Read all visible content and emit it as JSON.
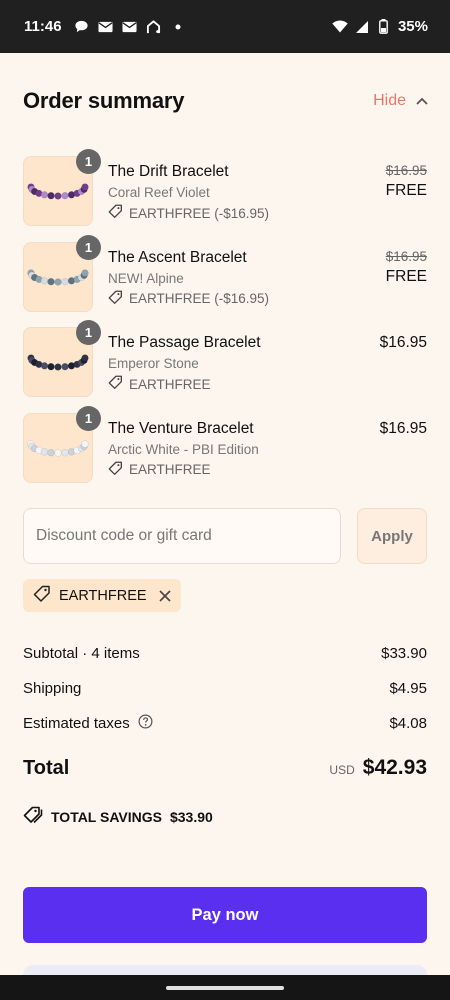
{
  "status_bar": {
    "time": "11:46",
    "battery": "35%",
    "icons": [
      "chat-bubble-icon",
      "mail-icon",
      "mail-icon",
      "home-icon",
      "dot-icon",
      "wifi-icon",
      "signal-icon",
      "battery-icon"
    ]
  },
  "header": {
    "title": "Order summary",
    "toggle_label": "Hide",
    "accent_color": "#e8786b"
  },
  "items": [
    {
      "name": "The Drift Bracelet",
      "variant": "Coral Reef Violet",
      "code": "EARTHFREE (-$16.95)",
      "original_price": "$16.95",
      "price": "FREE",
      "qty": "1",
      "bead_colors": [
        "#6e3d8c",
        "#b08ac8",
        "#4f2a6b"
      ]
    },
    {
      "name": "The Ascent Bracelet",
      "variant": "NEW! Alpine",
      "code": "EARTHFREE (-$16.95)",
      "original_price": "$16.95",
      "price": "FREE",
      "qty": "1",
      "bead_colors": [
        "#8ea3b0",
        "#d6dde2",
        "#5e7482"
      ]
    },
    {
      "name": "The Passage Bracelet",
      "variant": "Emperor Stone",
      "code": "EARTHFREE",
      "original_price": "",
      "price": "$16.95",
      "qty": "1",
      "bead_colors": [
        "#2f3146",
        "#4a4c66",
        "#1e2030"
      ]
    },
    {
      "name": "The Venture Bracelet",
      "variant": "Arctic White - PBI Edition",
      "code": "EARTHFREE",
      "original_price": "",
      "price": "$16.95",
      "qty": "1",
      "bead_colors": [
        "#f3f5f8",
        "#dfe6ee",
        "#c8d3de"
      ]
    }
  ],
  "discount": {
    "placeholder": "Discount code or gift card",
    "value": "",
    "apply_label": "Apply",
    "applied_code": "EARTHFREE"
  },
  "summary": {
    "subtotal_label": "Subtotal · 4 items",
    "subtotal_value": "$33.90",
    "shipping_label": "Shipping",
    "shipping_value": "$4.95",
    "taxes_label": "Estimated taxes",
    "taxes_value": "$4.08"
  },
  "total": {
    "label": "Total",
    "currency": "USD",
    "amount": "$42.93"
  },
  "savings": {
    "label": "TOTAL SAVINGS",
    "amount": "$33.90"
  },
  "pay": {
    "label": "Pay now",
    "color": "#5a2ff0"
  }
}
